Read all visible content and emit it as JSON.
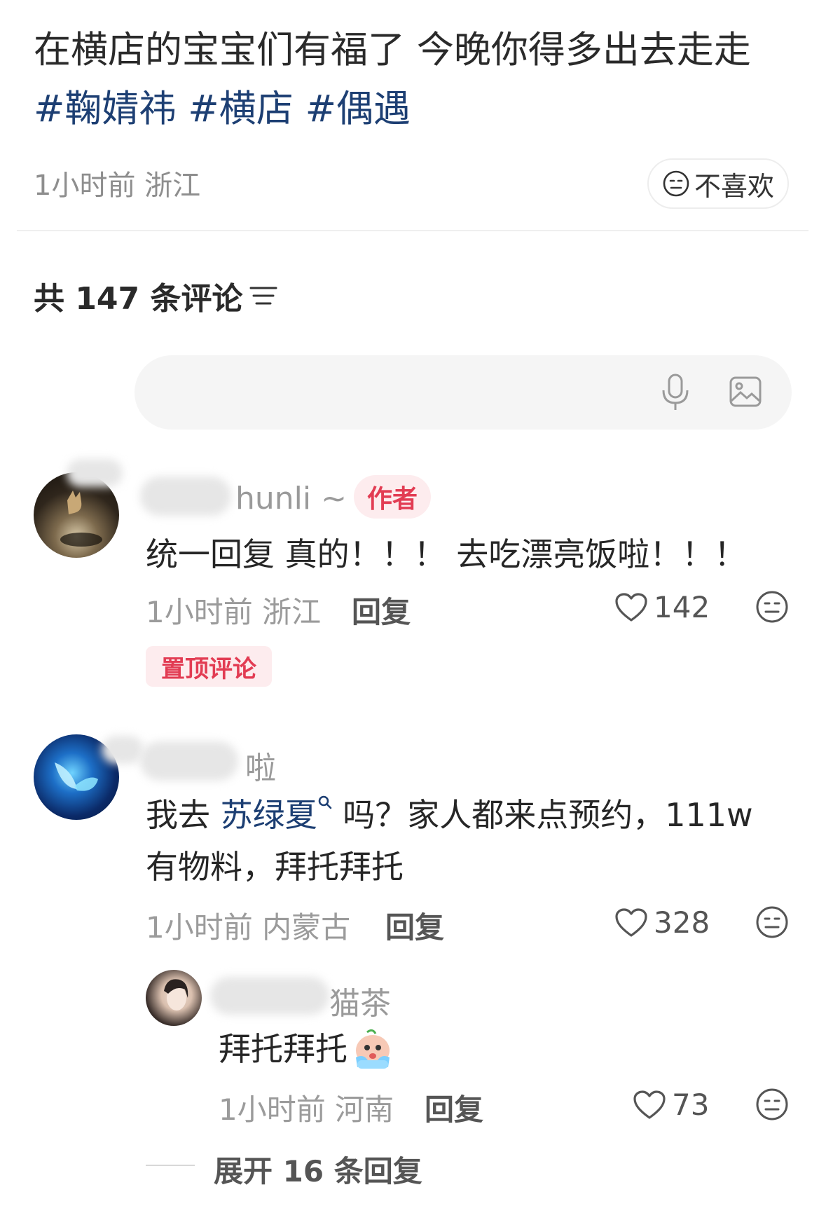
{
  "post": {
    "text": "在横店的宝宝们有福了 今晚你得多出去走走",
    "tags": [
      "#鞠婧祎",
      "#横店",
      "#偶遇"
    ],
    "time": "1小时前",
    "location": "浙江",
    "dislike_label": "不喜欢"
  },
  "comments_header": {
    "title": "共 147 条评论"
  },
  "comment_input": {
    "placeholder": ""
  },
  "comments": [
    {
      "username": "hunli ~",
      "badge": "作者",
      "text": "统一回复 真的！！！ 去吃漂亮饭啦！！！",
      "time": "1小时前",
      "location": "浙江",
      "reply_label": "回复",
      "likes": "142",
      "pinned_label": "置顶评论"
    },
    {
      "username": "啦",
      "text_before": "我去 ",
      "mention": "苏绿夏",
      "text_after": " 吗？家人都来点预约，111w",
      "text_line2": "有物料，拜托拜托",
      "time": "1小时前",
      "location": "内蒙古",
      "reply_label": "回复",
      "likes": "328",
      "replies": [
        {
          "username": "猫茶",
          "text": "拜托拜托",
          "time": "1小时前",
          "location": "河南",
          "reply_label": "回复",
          "likes": "73"
        }
      ],
      "expand_label": "展开 16 条回复"
    }
  ],
  "colors": {
    "accent": "#e23c53",
    "link": "#1d3f73"
  }
}
